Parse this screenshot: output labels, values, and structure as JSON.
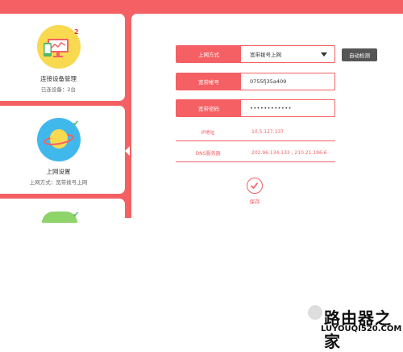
{
  "colors": {
    "accent": "#f46063",
    "device_icon_bg": "#f8d94f",
    "internet_icon_bg": "#41b8ec",
    "next_icon_bg": "#8fd36b",
    "check": "#4eb86a",
    "detect_button_bg": "#555555"
  },
  "sidebar": {
    "device_card": {
      "title": "连接设备管理",
      "subtitle": "已连设备：2台",
      "badge": "2",
      "icon": "monitor-devices-icon"
    },
    "internet_card": {
      "title": "上网设置",
      "subtitle": "上网方式：宽带拨号上网",
      "icon": "planet-icon",
      "status_icon": "check-icon"
    },
    "next_card": {
      "icon": "next-settings-icon",
      "status_icon": "check-icon"
    }
  },
  "form": {
    "connection_type": {
      "label": "上网方式",
      "value": "宽带拨号上网"
    },
    "detect_button": "自动检测",
    "account": {
      "label": "宽带帐号",
      "value": "0755fj35a409"
    },
    "password": {
      "label": "宽带密码",
      "value": "••••••••••••"
    },
    "ip": {
      "label": "IP地址",
      "value": "10.5.127.137"
    },
    "dns": {
      "label": "DNS服务器",
      "value": "202.96.134.133 , 210.21.196.6"
    },
    "save_label": "保存"
  },
  "watermark": {
    "logo_text": "路由器之家",
    "url": "LUYOUQI520.COM"
  }
}
